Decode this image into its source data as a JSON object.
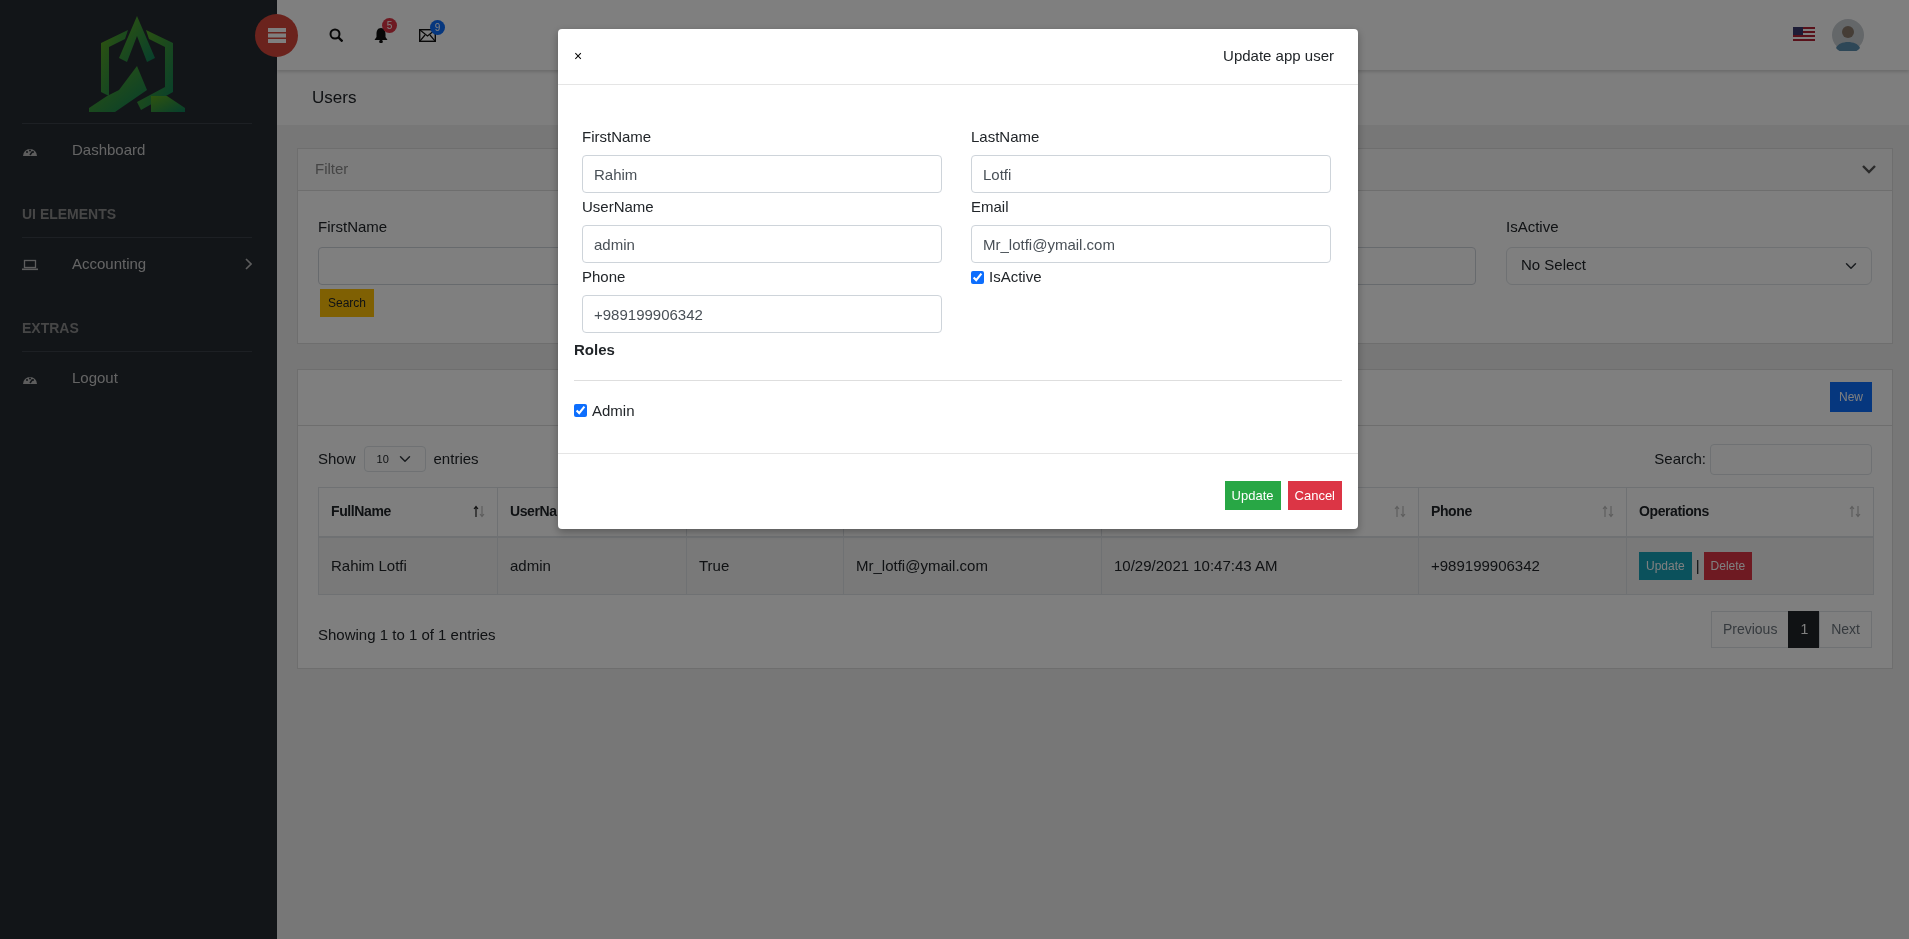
{
  "sidebar": {
    "items": [
      {
        "kind": "link",
        "label": "Dashboard"
      },
      {
        "kind": "heading",
        "label": "UI ELEMENTS"
      },
      {
        "kind": "submenu",
        "label": "Accounting"
      },
      {
        "kind": "heading",
        "label": "EXTRAS"
      },
      {
        "kind": "link",
        "label": "Logout"
      }
    ]
  },
  "topbar": {
    "notifications_badge": "5",
    "messages_badge": "9"
  },
  "page_title": "Users",
  "filter": {
    "title": "Filter",
    "fields": [
      {
        "kind": "text",
        "label": "FirstName"
      },
      {
        "kind": "text"
      },
      {
        "kind": "select",
        "label": "IsActive",
        "value": "No Select"
      }
    ],
    "button": "Search"
  },
  "table_card": {
    "new_button": "New",
    "show_label": "Show",
    "page_length": "10",
    "entries_label": "entries",
    "search_label": "Search:",
    "columns": [
      {
        "label": "FullName",
        "sorted": true
      },
      {
        "label": "UserNa"
      },
      {},
      {},
      {
        "sorted": false
      },
      {
        "label": "Phone",
        "sorted": false
      },
      {
        "label": "Operations",
        "sorted": false
      }
    ],
    "rows": [
      {
        "cells": [
          "Rahim Lotfi",
          "admin",
          "True",
          "Mr_lotfi@ymail.com",
          "10/29/2021 10:47:43 AM",
          "+989199906342"
        ],
        "actions": [
          {
            "label": "Update",
            "kind": "edit"
          },
          {
            "label": "|",
            "kind": "separator"
          },
          {
            "label": "Delete",
            "kind": "delete"
          }
        ]
      }
    ],
    "info": "Showing 1 to 1 of 1 entries",
    "pagination": [
      {
        "label": "Previous",
        "selected": false,
        "disabled": true
      },
      {
        "label": "1",
        "selected": true,
        "disabled": false
      },
      {
        "label": "Next",
        "selected": false,
        "disabled": true
      }
    ]
  },
  "modal": {
    "close": "×",
    "title": "Update app user",
    "fields": [
      {
        "kind": "text",
        "label": "FirstName",
        "value": "Rahim"
      },
      {
        "kind": "text",
        "label": "LastName",
        "value": "Lotfi"
      },
      {
        "kind": "text",
        "label": "UserName",
        "value": "admin"
      },
      {
        "kind": "text",
        "label": "Email",
        "value": "Mr_lotfi@ymail.com"
      },
      {
        "kind": "text",
        "label": "Phone",
        "value": "+989199906342"
      },
      {
        "kind": "checkbox",
        "label": "IsActive",
        "checked": true
      }
    ],
    "roles_heading": "Roles",
    "roles": [
      {
        "label": "Admin",
        "checked": true
      }
    ],
    "buttons": [
      {
        "label": "Update",
        "kind": "confirm"
      },
      {
        "label": "Cancel",
        "kind": "cancel"
      }
    ]
  }
}
